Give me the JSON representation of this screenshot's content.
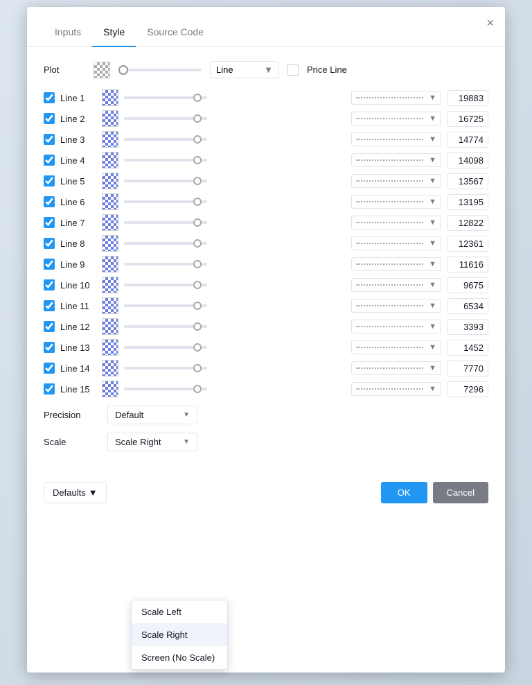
{
  "tabs": [
    {
      "label": "Inputs",
      "active": false
    },
    {
      "label": "Style",
      "active": true
    },
    {
      "label": "Source Code",
      "active": false
    }
  ],
  "close_label": "×",
  "plot": {
    "label": "Plot",
    "line_type": "Line",
    "price_line_label": "Price Line"
  },
  "lines": [
    {
      "name": "Line 1",
      "value": "19883"
    },
    {
      "name": "Line 2",
      "value": "16725"
    },
    {
      "name": "Line 3",
      "value": "14774"
    },
    {
      "name": "Line 4",
      "value": "14098"
    },
    {
      "name": "Line 5",
      "value": "13567"
    },
    {
      "name": "Line 6",
      "value": "13195"
    },
    {
      "name": "Line 7",
      "value": "12822"
    },
    {
      "name": "Line 8",
      "value": "12361"
    },
    {
      "name": "Line 9",
      "value": "11616"
    },
    {
      "name": "Line 10",
      "value": "9675"
    },
    {
      "name": "Line 11",
      "value": "6534"
    },
    {
      "name": "Line 12",
      "value": "3393"
    },
    {
      "name": "Line 13",
      "value": "1452"
    },
    {
      "name": "Line 14",
      "value": "7770"
    },
    {
      "name": "Line 15",
      "value": "7296"
    }
  ],
  "precision": {
    "label": "Precision",
    "value": "Default"
  },
  "scale": {
    "label": "Scale",
    "value": "Scale Right",
    "options": [
      {
        "label": "Scale Left",
        "selected": false
      },
      {
        "label": "Scale Right",
        "selected": true
      },
      {
        "label": "Screen (No Scale)",
        "selected": false
      }
    ]
  },
  "footer": {
    "defaults_label": "Defaults",
    "defaults_arrow": "▼",
    "ok_label": "OK",
    "cancel_label": "Cancel"
  }
}
